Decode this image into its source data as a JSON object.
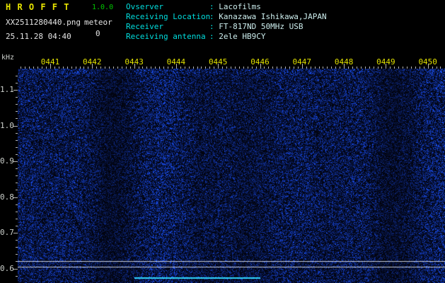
{
  "app": {
    "title": "H R O F F T",
    "version": "1.0.0",
    "filename": "XX2511280440.png",
    "mode_label": "meteor",
    "event_count": "0",
    "datetime": "25.11.28 04:40"
  },
  "info": {
    "rows": [
      {
        "label": "Ovserver",
        "value": "Lacofilms"
      },
      {
        "label": "Receiving Location",
        "value": "Kanazawa Ishikawa,JAPAN"
      },
      {
        "label": "Receiver",
        "value": "FT-817ND 50MHz USB"
      },
      {
        "label": "Receiving antenna",
        "value": "2ele HB9CY"
      }
    ]
  },
  "chart_data": {
    "type": "heatmap",
    "subtype": "radio meteor spectrogram (time vs audio frequency waterfall)",
    "x_axis": {
      "tick_labels": [
        "0441",
        "0442",
        "0443",
        "0444",
        "0445",
        "0446",
        "0447",
        "0448",
        "0449",
        "0450"
      ],
      "unit": "time HHMM",
      "interval_minutes": 1
    },
    "y_axis": {
      "label": "kHz",
      "tick_labels": [
        "1.1",
        "1.0",
        "0.9",
        "0.8",
        "0.7",
        "0.6"
      ],
      "top_khz": 1.16,
      "bottom_khz": 0.56,
      "minor_tick_step_khz": 0.02
    },
    "content_summary": "uniform dense blue background noise over black, no meteor echo bursts visible",
    "carrier_lines": [
      {
        "freq_khz": 0.62,
        "extent": "full width",
        "color": "#c8cede"
      },
      {
        "freq_khz": 0.605,
        "extent": "full width",
        "color": "#c8cede"
      }
    ],
    "partial_trace": {
      "freq_khz": 0.575,
      "start_label": "0443",
      "end_label": "0446",
      "color": "#30d8ff"
    }
  },
  "colors": {
    "background": "#000000",
    "title": "#e8e400",
    "version": "#00c800",
    "header_text": "#e4e4e4",
    "info_label": "#00dede",
    "info_value": "#cdeeee",
    "time_labels": "#e0e000",
    "freq_labels": "#ccd0cc",
    "ticks": "#b4b4b4",
    "noise_base": "#02030c",
    "noise_speckle": "#1030c8",
    "noise_bright": "#40c8ff"
  }
}
